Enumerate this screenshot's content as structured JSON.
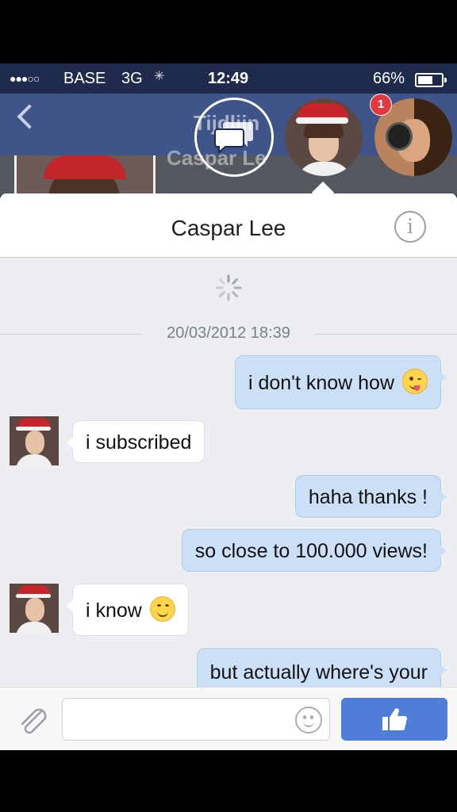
{
  "status_bar": {
    "signal": "●●●○○",
    "carrier": "BASE",
    "network": "3G",
    "time": "12:49",
    "battery_percent": "66%",
    "battery_level": 0.66
  },
  "background_page": {
    "title": "Tijdlijn",
    "name": "Caspar Le"
  },
  "chat_heads": {
    "badge_count": "1"
  },
  "chat": {
    "contact_name": "Caspar Lee",
    "timestamp": "20/03/2012 18:39",
    "messages": [
      {
        "direction": "out",
        "text": "i don't know how",
        "emoji": "winking-tongue-emoji"
      },
      {
        "direction": "in",
        "text": "i subscribed"
      },
      {
        "direction": "out",
        "text": "haha thanks !"
      },
      {
        "direction": "out",
        "text": "so close to 100.000 views!"
      },
      {
        "direction": "in",
        "text": "i know",
        "emoji": "smiling-emoji"
      },
      {
        "direction": "out",
        "text": "but actually where's your"
      }
    ]
  },
  "compose": {
    "placeholder": ""
  },
  "colors": {
    "nav_bar": "#3f5488",
    "outgoing_bubble": "#cbe0f7",
    "incoming_bubble": "#ffffff",
    "like_button": "#4e7ed8",
    "badge": "#e0393e"
  }
}
